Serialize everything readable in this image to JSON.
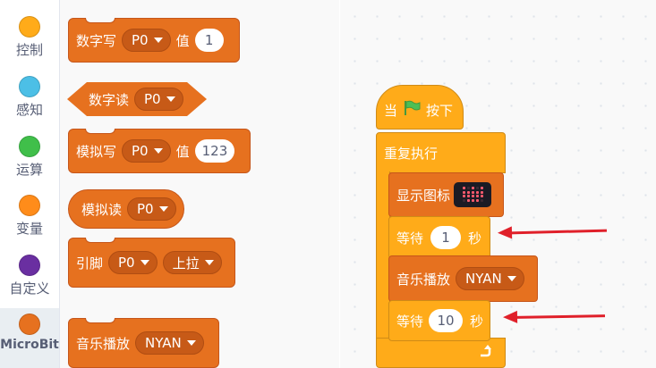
{
  "categories": [
    {
      "label": "控制",
      "color": "#ffab19",
      "icon": "control-icon"
    },
    {
      "label": "感知",
      "color": "#4cbfe6",
      "icon": "sensing-icon"
    },
    {
      "label": "运算",
      "color": "#40bf4a",
      "icon": "operators-icon"
    },
    {
      "label": "变量",
      "color": "#ff8c1a",
      "icon": "variables-icon"
    },
    {
      "label": "自定义",
      "color": "#6a2fa1",
      "icon": "custom-icon"
    },
    {
      "label": "MicroBit",
      "color": "#e6711f",
      "icon": "microbit-icon"
    }
  ],
  "palette": {
    "digital_write": {
      "label": "数字写",
      "pin": "P0",
      "value_label": "值",
      "value": "1"
    },
    "digital_read": {
      "label": "数字读",
      "pin": "P0"
    },
    "analog_write": {
      "label": "模拟写",
      "pin": "P0",
      "value_label": "值",
      "value": "123"
    },
    "analog_read": {
      "label": "模拟读",
      "pin": "P0"
    },
    "pin_pull": {
      "label": "引脚",
      "pin": "P0",
      "mode": "上拉"
    },
    "music_play": {
      "label": "音乐播放",
      "melody": "NYAN"
    }
  },
  "workspace": {
    "hat": {
      "prefix": "当",
      "suffix": "按下"
    },
    "repeat": {
      "label": "重复执行"
    },
    "show_icon": {
      "label": "显示图标"
    },
    "wait1": {
      "label": "等待",
      "value": "1",
      "unit": "秒"
    },
    "music": {
      "label": "音乐播放",
      "melody": "NYAN"
    },
    "wait2": {
      "label": "等待",
      "value": "10",
      "unit": "秒"
    }
  },
  "colors": {
    "control": "#ffab19",
    "microbit": "#e6711f",
    "arrow": "#e0202a"
  }
}
